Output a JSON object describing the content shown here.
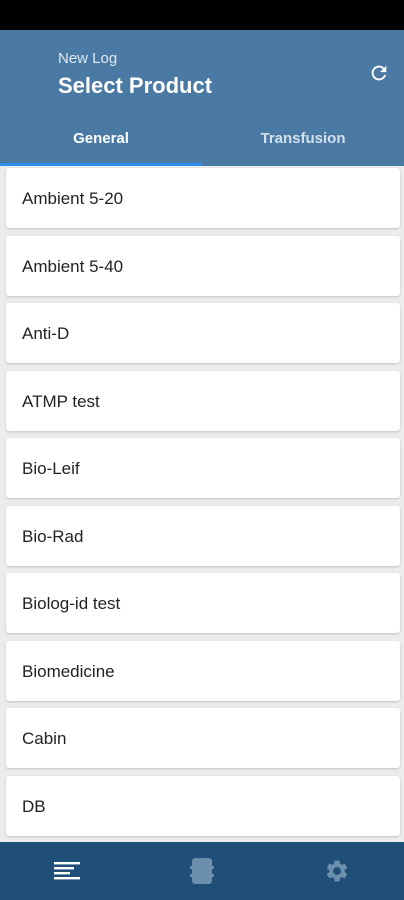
{
  "header": {
    "subtitle": "New Log",
    "title": "Select Product"
  },
  "tabs": [
    {
      "label": "General",
      "active": true
    },
    {
      "label": "Transfusion",
      "active": false
    }
  ],
  "products": [
    {
      "label": "Ambient 5-20"
    },
    {
      "label": "Ambient 5-40"
    },
    {
      "label": "Anti-D"
    },
    {
      "label": "ATMP test"
    },
    {
      "label": "Bio-Leif"
    },
    {
      "label": "Bio-Rad"
    },
    {
      "label": "Biolog-id test"
    },
    {
      "label": "Biomedicine"
    },
    {
      "label": "Cabin"
    },
    {
      "label": "DB"
    }
  ],
  "bottom_nav": [
    {
      "icon": "list-icon",
      "active": true
    },
    {
      "icon": "container-icon",
      "active": false
    },
    {
      "icon": "gear-icon",
      "active": false
    }
  ],
  "colors": {
    "header": "#4a7aa3",
    "tab_indicator": "#2f8ff0",
    "bottom_nav": "#1f4e79"
  }
}
